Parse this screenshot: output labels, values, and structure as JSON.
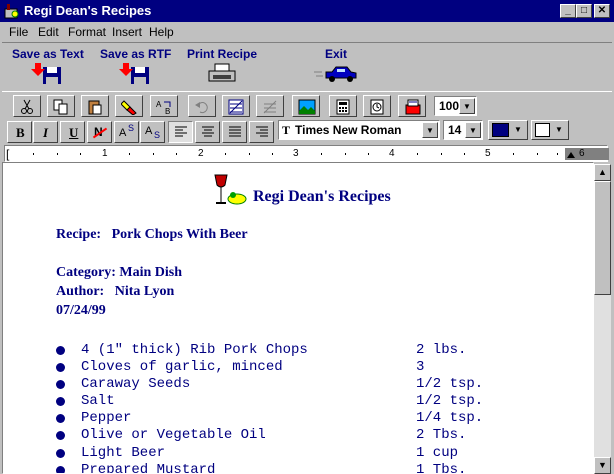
{
  "window": {
    "title": "Regi Dean's Recipes"
  },
  "menu": [
    "File",
    "Edit",
    "Format",
    "Insert",
    "Help"
  ],
  "bigbar": {
    "save_text": "Save as Text",
    "save_rtf": "Save as RTF",
    "print": "Print Recipe",
    "exit": "Exit"
  },
  "toolbar": {
    "zoom": "100",
    "font": "Times New Roman",
    "size": "14",
    "text_color": "#000080",
    "back_color": "#ffffff"
  },
  "ruler": [
    "1",
    "2",
    "3",
    "4",
    "5",
    "6"
  ],
  "document": {
    "title": "Regi Dean's Recipes",
    "recipe_line": "Recipe:   Pork Chops With Beer",
    "category_line": "Category: Main Dish",
    "author_line": "Author:   Nita Lyon",
    "date": "07/24/99",
    "ingredients": [
      {
        "name": "4 (1\" thick) Rib Pork Chops",
        "qty": "2 lbs."
      },
      {
        "name": "Cloves of garlic, minced",
        "qty": "3"
      },
      {
        "name": "Caraway Seeds",
        "qty": "1/2 tsp."
      },
      {
        "name": "Salt",
        "qty": "1/2 tsp."
      },
      {
        "name": "Pepper",
        "qty": "1/4 tsp."
      },
      {
        "name": "Olive or Vegetable Oil",
        "qty": "2 Tbs."
      },
      {
        "name": "Light Beer",
        "qty": "1 cup"
      },
      {
        "name": "Prepared Mustard",
        "qty": "1 Tbs."
      }
    ]
  }
}
